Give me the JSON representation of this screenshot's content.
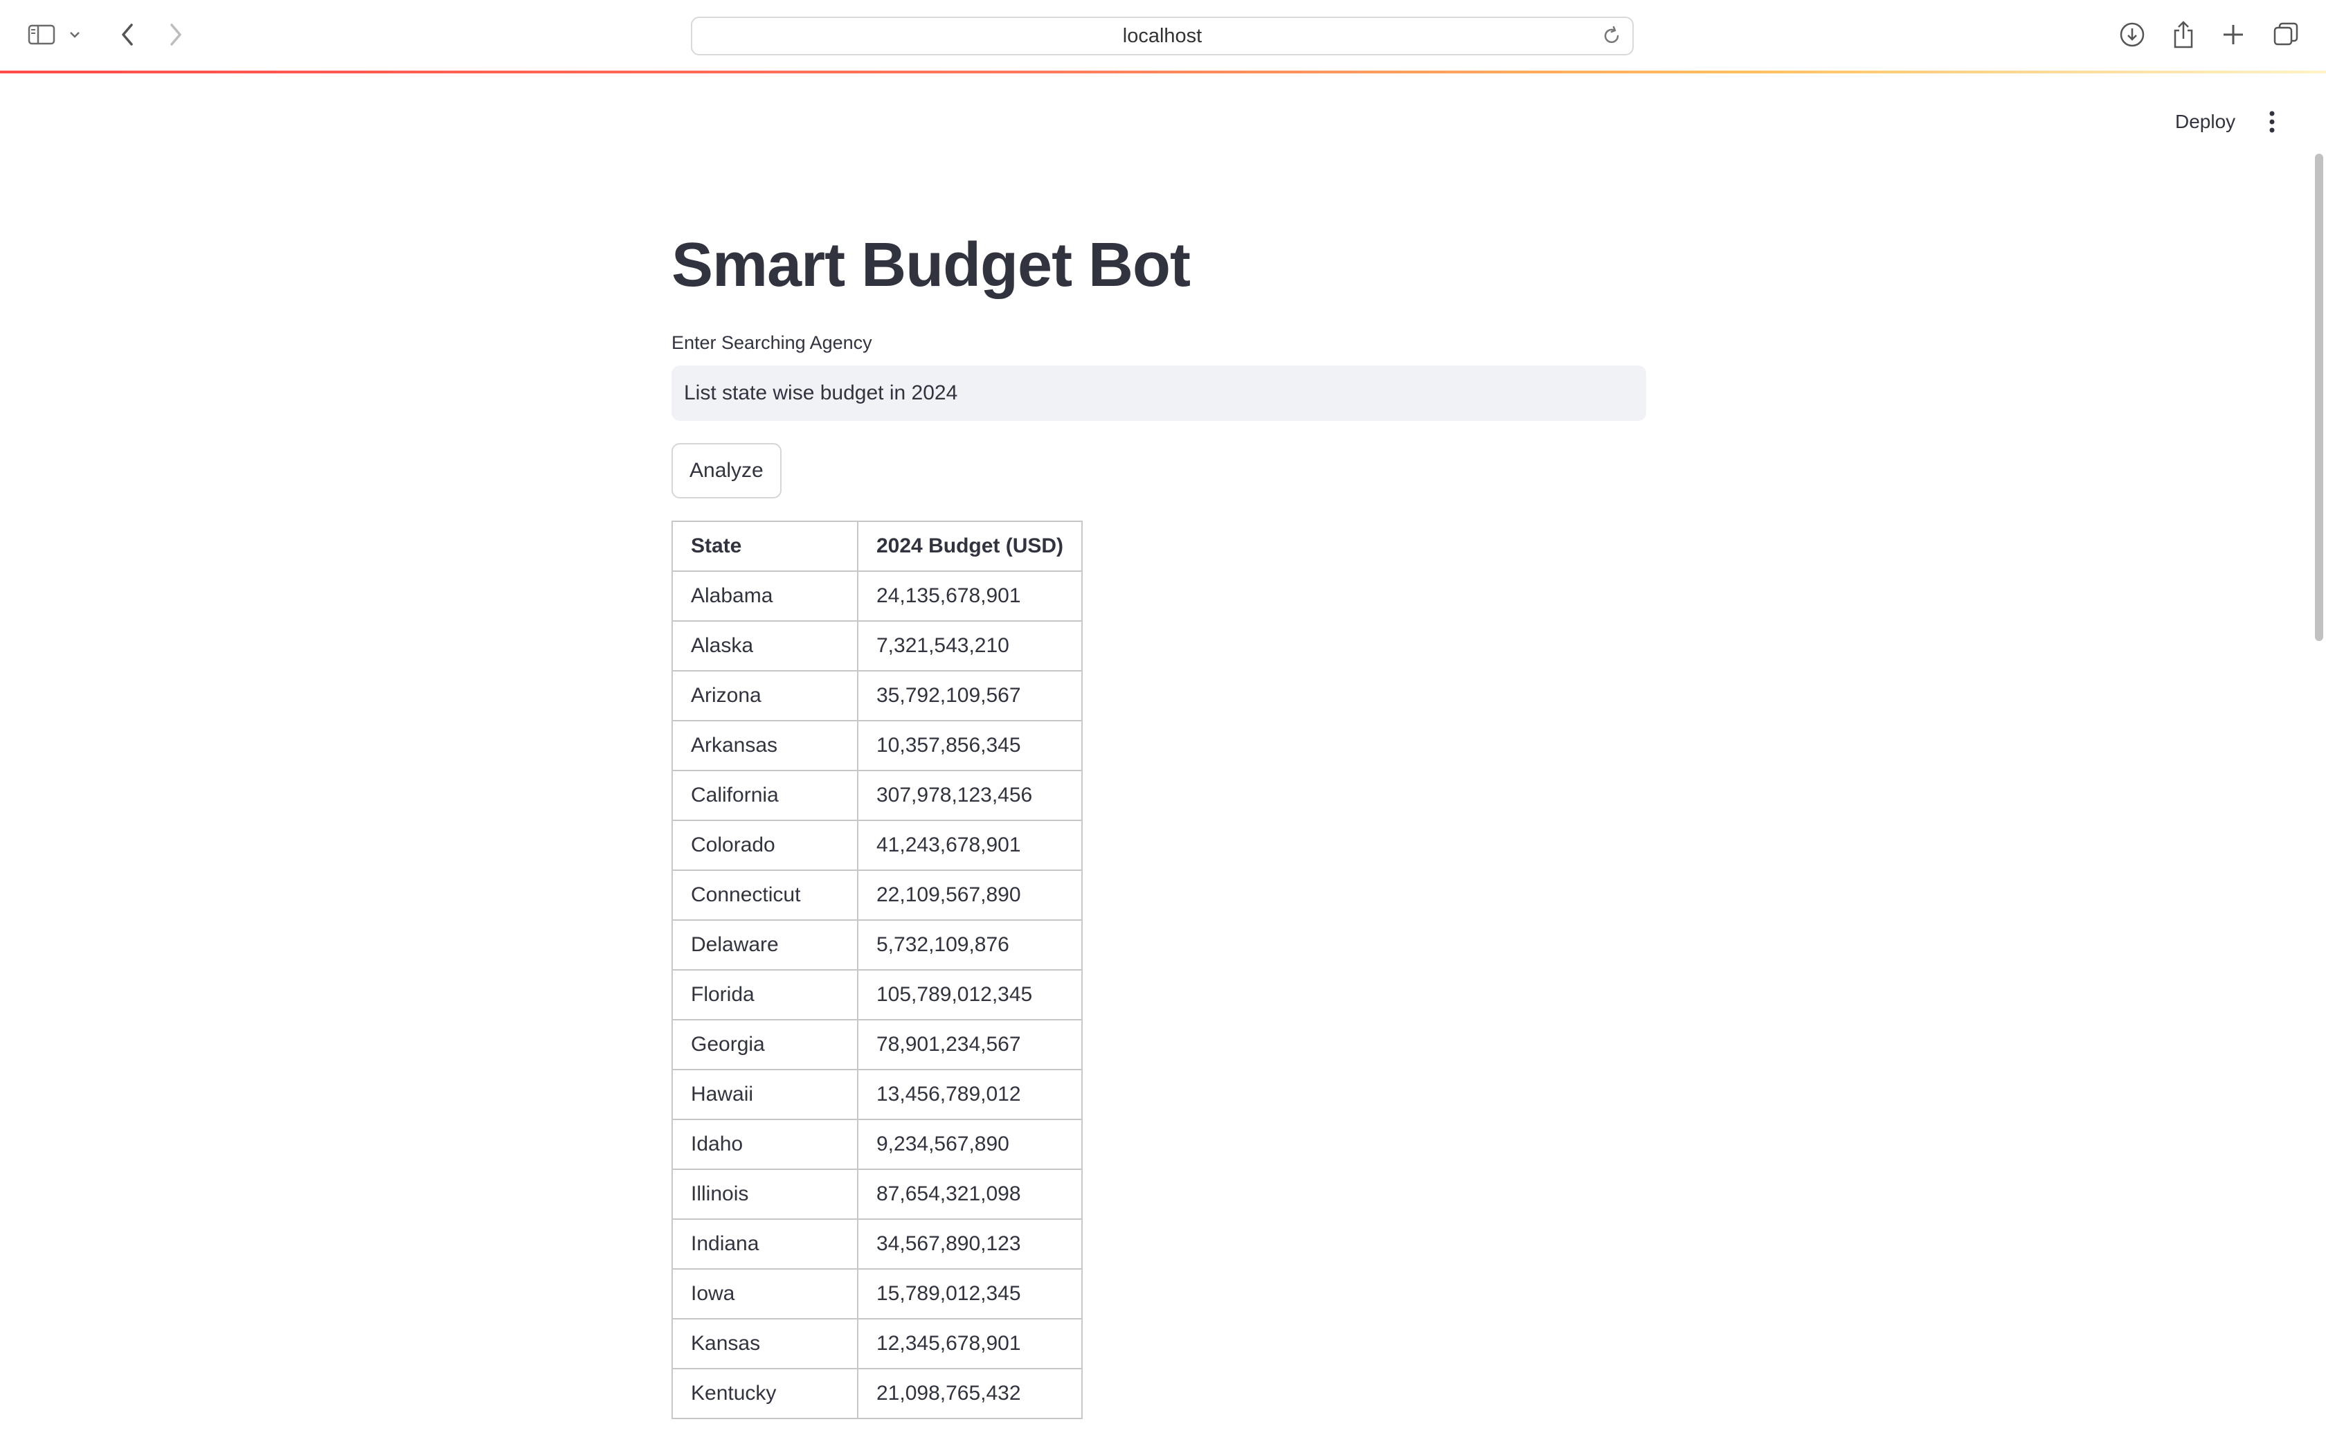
{
  "browser": {
    "url": "localhost",
    "icons": [
      "sidebar-icon",
      "chevron-down-icon",
      "back-icon",
      "forward-icon",
      "reload-icon",
      "download-icon",
      "share-icon",
      "new-tab-icon",
      "tabs-overview-icon"
    ]
  },
  "header": {
    "deploy_label": "Deploy",
    "menu_icon": "more-vertical-icon"
  },
  "main": {
    "title": "Smart Budget Bot",
    "input_label": "Enter Searching Agency",
    "input_value": "List state wise budget in 2024",
    "analyze_label": "Analyze"
  },
  "table": {
    "headers": [
      "State",
      "2024 Budget (USD)"
    ],
    "rows": [
      [
        "Alabama",
        "24,135,678,901"
      ],
      [
        "Alaska",
        "7,321,543,210"
      ],
      [
        "Arizona",
        "35,792,109,567"
      ],
      [
        "Arkansas",
        "10,357,856,345"
      ],
      [
        "California",
        "307,978,123,456"
      ],
      [
        "Colorado",
        "41,243,678,901"
      ],
      [
        "Connecticut",
        "22,109,567,890"
      ],
      [
        "Delaware",
        "5,732,109,876"
      ],
      [
        "Florida",
        "105,789,012,345"
      ],
      [
        "Georgia",
        "78,901,234,567"
      ],
      [
        "Hawaii",
        "13,456,789,012"
      ],
      [
        "Idaho",
        "9,234,567,890"
      ],
      [
        "Illinois",
        "87,654,321,098"
      ],
      [
        "Indiana",
        "34,567,890,123"
      ],
      [
        "Iowa",
        "15,789,012,345"
      ],
      [
        "Kansas",
        "12,345,678,901"
      ],
      [
        "Kentucky",
        "21,098,765,432"
      ]
    ]
  }
}
